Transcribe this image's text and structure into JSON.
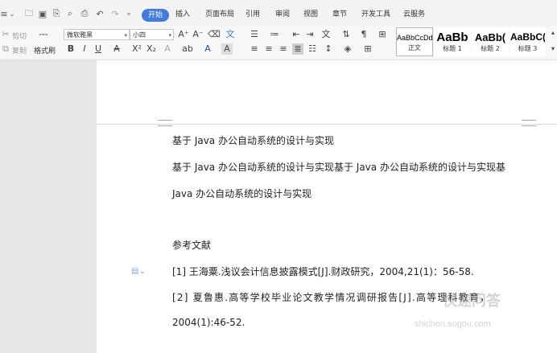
{
  "menu": {
    "tabs": [
      "开始",
      "插入",
      "页面布局",
      "引用",
      "审阅",
      "视图",
      "章节",
      "开发工具",
      "云服务"
    ],
    "active_tab": "开始"
  },
  "ribbon": {
    "cut": "剪切",
    "copy": "复制",
    "format_painter": "格式刷",
    "font_name": "微软雅黑",
    "font_size": "小四",
    "styles": [
      {
        "sample": "AaBbCcDd",
        "name": "正文"
      },
      {
        "sample": "AaBb",
        "name": "标题 1"
      },
      {
        "sample": "AaBb(",
        "name": "标题 2"
      },
      {
        "sample": "AaBbC(",
        "name": "标题 3"
      }
    ]
  },
  "document": {
    "paragraphs": [
      "基于 Java 办公自动系统的设计与实现",
      "基于 Java 办公自动系统的设计与实现基于 Java 办公自动系统的设计与实现基",
      "Java 办公自动系统的设计与实现",
      "参考文献",
      "[1]  王海粟.浅议会计信息披露模式[J].财政研究，2004,21(1)：56-58.",
      "[2]  夏鲁惠.高等学校毕业论文教学情况调研报告[J].高等理科教育，",
      "2004(1):46-52."
    ]
  },
  "watermark": {
    "brand": "快速问答",
    "url": "shichen.sogou.com"
  }
}
